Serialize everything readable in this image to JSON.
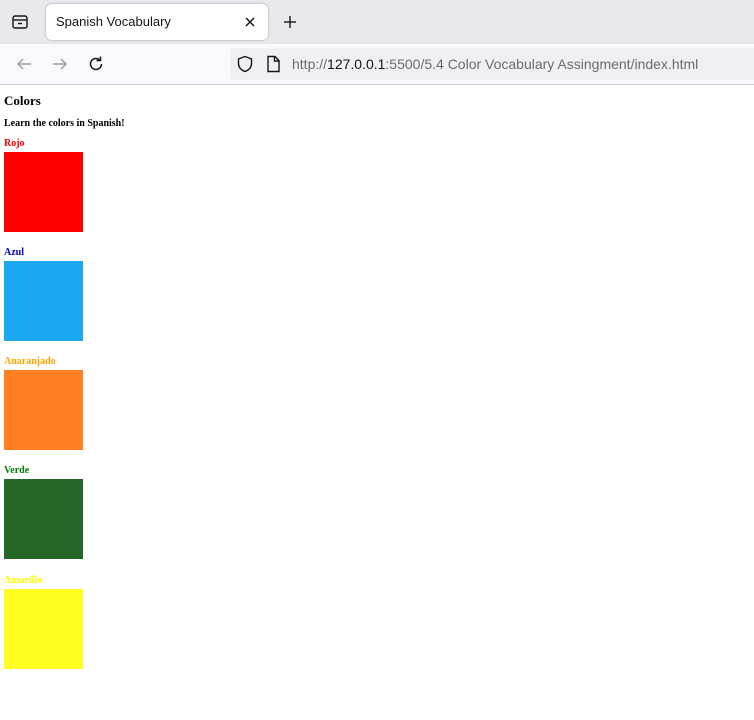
{
  "browser": {
    "tab": {
      "title": "Spanish Vocabulary"
    },
    "url": {
      "scheme": "http://",
      "host": "127.0.0.1",
      "rest": ":5500/5.4 Color Vocabulary Assingment/index.html"
    }
  },
  "page": {
    "title": "Colors",
    "subtitle": "Learn the colors in Spanish!",
    "colors": [
      {
        "name": "Rojo",
        "label_color": "#ff0000",
        "swatch_color": "#ff0000"
      },
      {
        "name": "Azul",
        "label_color": "#0000cc",
        "swatch_color": "#1ba8f0"
      },
      {
        "name": "Anaranjado",
        "label_color": "#ffa500",
        "swatch_color": "#ff7f23"
      },
      {
        "name": "Verde",
        "label_color": "#008000",
        "swatch_color": "#256629"
      },
      {
        "name": "Amarillo",
        "label_color": "#ffff00",
        "swatch_color": "#ffff22"
      }
    ]
  }
}
